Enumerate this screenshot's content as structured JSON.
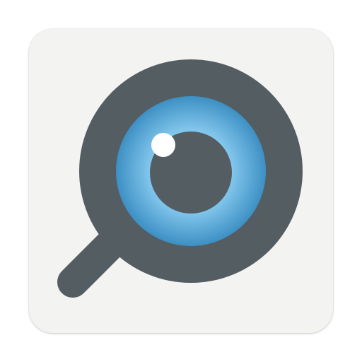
{
  "app_icon": {
    "icon": "magnifier-eye-icon",
    "colors": {
      "tile_background": "#f3f3f2",
      "lens_frame": "#545d62",
      "handle": "#545d62",
      "iris_outer": "#3f95c8",
      "iris_inner": "#9fd4f1",
      "pupil": "#545d62",
      "highlight": "#ffffff"
    }
  }
}
